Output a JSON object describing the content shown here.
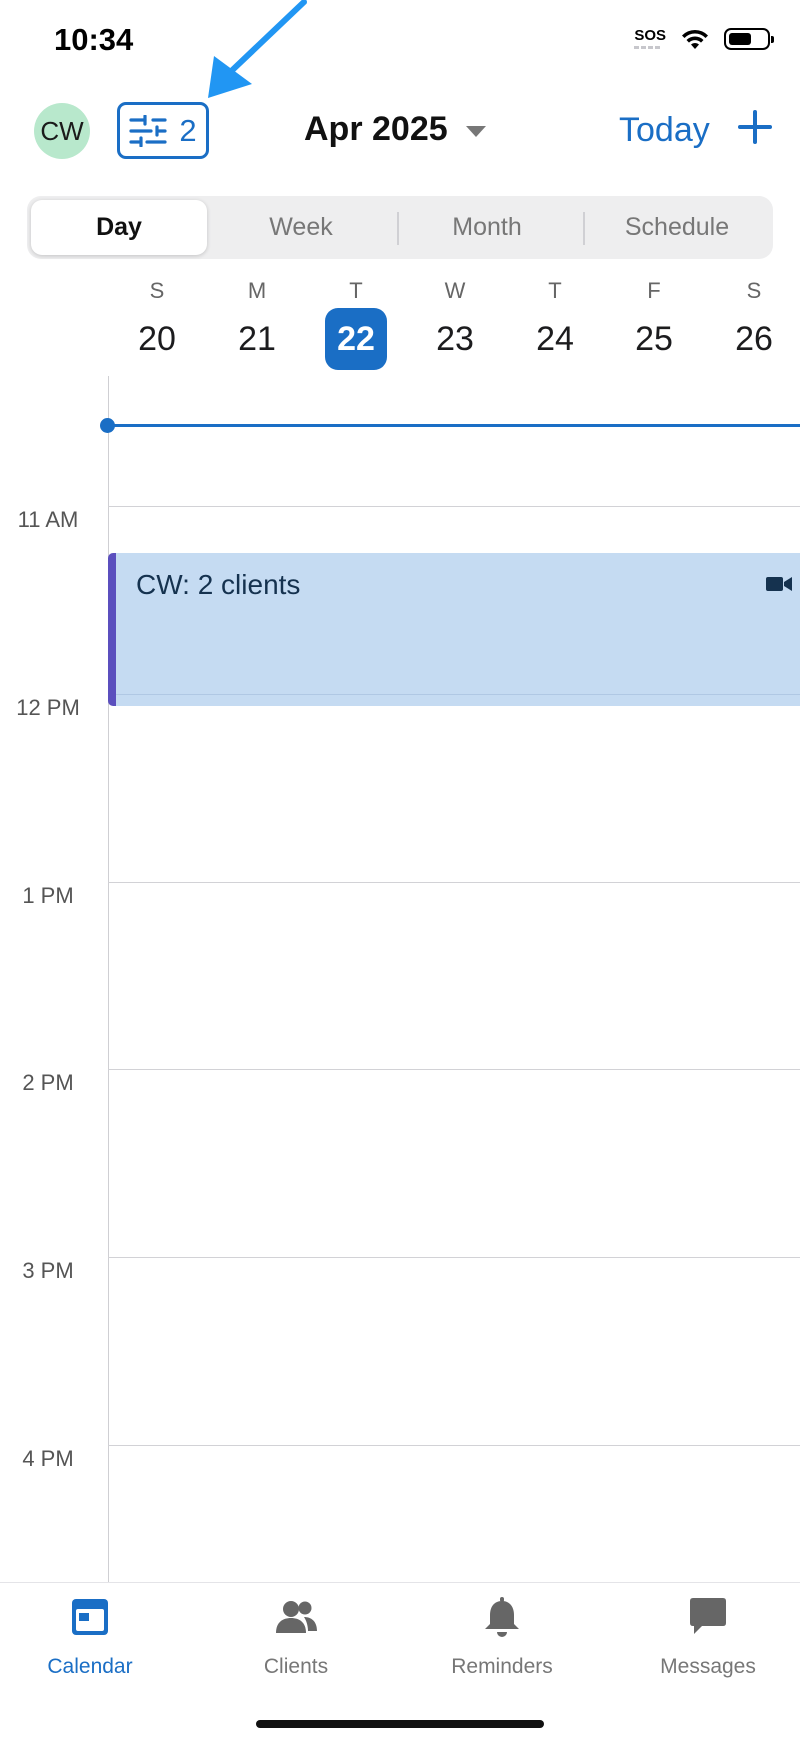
{
  "status_bar": {
    "time": "10:34",
    "sos": "SOS",
    "battery_level": 0.6
  },
  "header": {
    "avatar_initials": "CW",
    "filter_count": "2",
    "month_title": "Apr 2025",
    "today_label": "Today"
  },
  "view_tabs": [
    {
      "label": "Day",
      "active": true
    },
    {
      "label": "Week",
      "active": false
    },
    {
      "label": "Month",
      "active": false
    },
    {
      "label": "Schedule",
      "active": false
    }
  ],
  "week": [
    {
      "dow": "S",
      "date": "20"
    },
    {
      "dow": "M",
      "date": "21"
    },
    {
      "dow": "T",
      "date": "22",
      "selected": true
    },
    {
      "dow": "W",
      "date": "23"
    },
    {
      "dow": "T",
      "date": "24"
    },
    {
      "dow": "F",
      "date": "25"
    },
    {
      "dow": "S",
      "date": "26"
    }
  ],
  "timeline": {
    "hours": [
      "11 AM",
      "12 PM",
      "1 PM",
      "2 PM",
      "3 PM",
      "4 PM"
    ]
  },
  "event": {
    "title": "CW: 2 clients",
    "icon": "video-camera-icon",
    "color": "#c5dbf2",
    "accent": "#5b4fbe"
  },
  "tabbar": [
    {
      "label": "Calendar",
      "icon": "calendar-icon",
      "active": true
    },
    {
      "label": "Clients",
      "icon": "people-icon",
      "active": false
    },
    {
      "label": "Reminders",
      "icon": "bell-icon",
      "active": false
    },
    {
      "label": "Messages",
      "icon": "message-bubble-icon",
      "active": false
    }
  ],
  "colors": {
    "accent": "#1a6ec5",
    "annotation_arrow": "#2196f3"
  }
}
